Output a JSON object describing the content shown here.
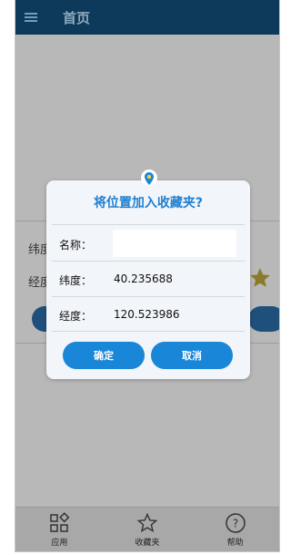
{
  "header": {
    "title": "首页",
    "menu_icon": "menu-icon"
  },
  "background_form": {
    "latitude_label": "纬度",
    "longitude_label": "经度"
  },
  "dialog": {
    "title": "将位置加入收藏夹?",
    "name_label": "名称：",
    "name_value": "",
    "latitude_label": "纬度：",
    "latitude_value": "40.235688",
    "longitude_label": "经度：",
    "longitude_value": "120.523986",
    "confirm_label": "确定",
    "cancel_label": "取消"
  },
  "bottom_nav": {
    "items": [
      {
        "label": "应用",
        "icon": "apps-icon"
      },
      {
        "label": "收藏夹",
        "icon": "star-icon"
      },
      {
        "label": "帮助",
        "icon": "help-icon"
      }
    ]
  },
  "colors": {
    "appbar": "#0d3a5b",
    "accent": "#1a86d8",
    "title_text": "#1f7fd1",
    "star": "#f2c100"
  }
}
